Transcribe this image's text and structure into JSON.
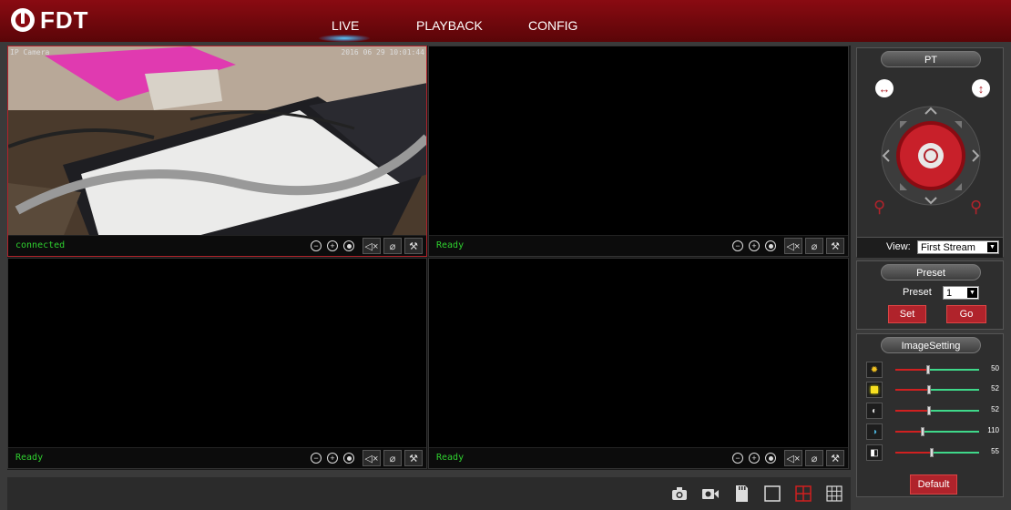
{
  "app": {
    "brand": "FDT"
  },
  "nav": {
    "tabs": [
      {
        "label": "LIVE",
        "active": true
      },
      {
        "label": "PLAYBACK"
      },
      {
        "label": "CONFIG"
      }
    ]
  },
  "cells": [
    {
      "status": "connected",
      "osd_name": "IP Camera",
      "osd_time": "2016 06 29 10:01:44"
    },
    {
      "status": "Ready"
    },
    {
      "status": "Ready"
    },
    {
      "status": "Ready"
    }
  ],
  "ptz": {
    "title": "PT",
    "view_label": "View:",
    "view_value": "First Stream"
  },
  "preset": {
    "title": "Preset",
    "label": "Preset",
    "value": "1",
    "set_label": "Set",
    "go_label": "Go"
  },
  "image_setting": {
    "title": "ImageSetting",
    "sliders": [
      {
        "name": "hue",
        "value": "50",
        "fraction": 0.39
      },
      {
        "name": "brightness",
        "value": "52",
        "fraction": 0.4
      },
      {
        "name": "contrast",
        "value": "52",
        "fraction": 0.4
      },
      {
        "name": "saturation",
        "value": "110",
        "fraction": 0.33
      },
      {
        "name": "sharpness",
        "value": "55",
        "fraction": 0.43
      }
    ],
    "default_label": "Default"
  },
  "colors": {
    "brand_red": "#b0232b",
    "status_green": "#2fd02f",
    "slider_green": "#3fd88a"
  }
}
